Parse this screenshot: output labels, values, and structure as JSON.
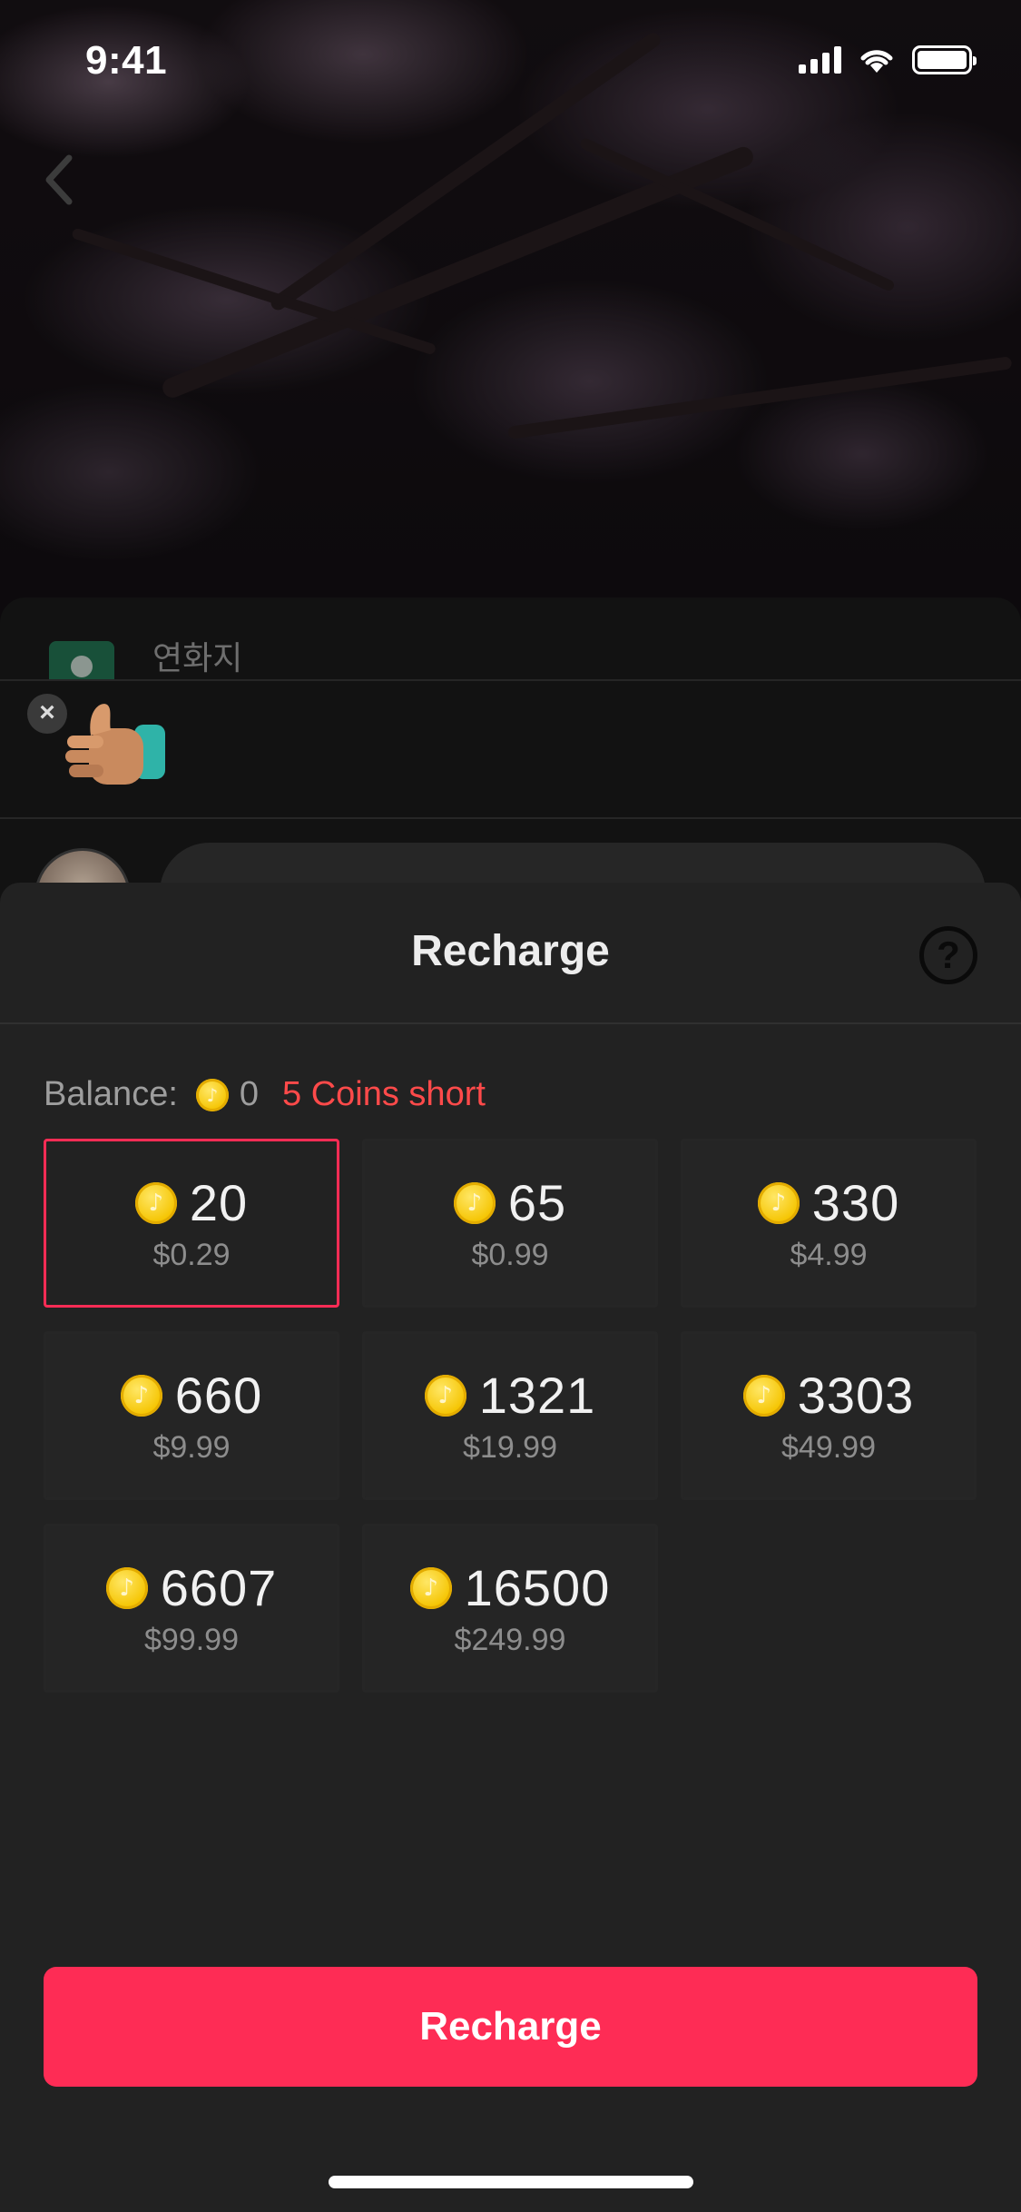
{
  "status_bar": {
    "time": "9:41"
  },
  "background": {
    "comment_author": "연화지"
  },
  "sheet": {
    "title": "Recharge",
    "help_icon": "question-circle-icon",
    "balance": {
      "label": "Balance:",
      "value": "0",
      "shortfall": "5 Coins short"
    },
    "packages": [
      {
        "coins": "20",
        "price": "$0.29",
        "selected": true
      },
      {
        "coins": "65",
        "price": "$0.99",
        "selected": false
      },
      {
        "coins": "330",
        "price": "$4.99",
        "selected": false
      },
      {
        "coins": "660",
        "price": "$9.99",
        "selected": false
      },
      {
        "coins": "1321",
        "price": "$19.99",
        "selected": false
      },
      {
        "coins": "3303",
        "price": "$49.99",
        "selected": false
      },
      {
        "coins": "6607",
        "price": "$99.99",
        "selected": false
      },
      {
        "coins": "16500",
        "price": "$249.99",
        "selected": false
      }
    ],
    "recharge_button": "Recharge"
  },
  "colors": {
    "accent": "#fe2c55",
    "short_text": "#ff4a4a",
    "coin": "#f5c400",
    "sheet_bg": "#222222"
  }
}
